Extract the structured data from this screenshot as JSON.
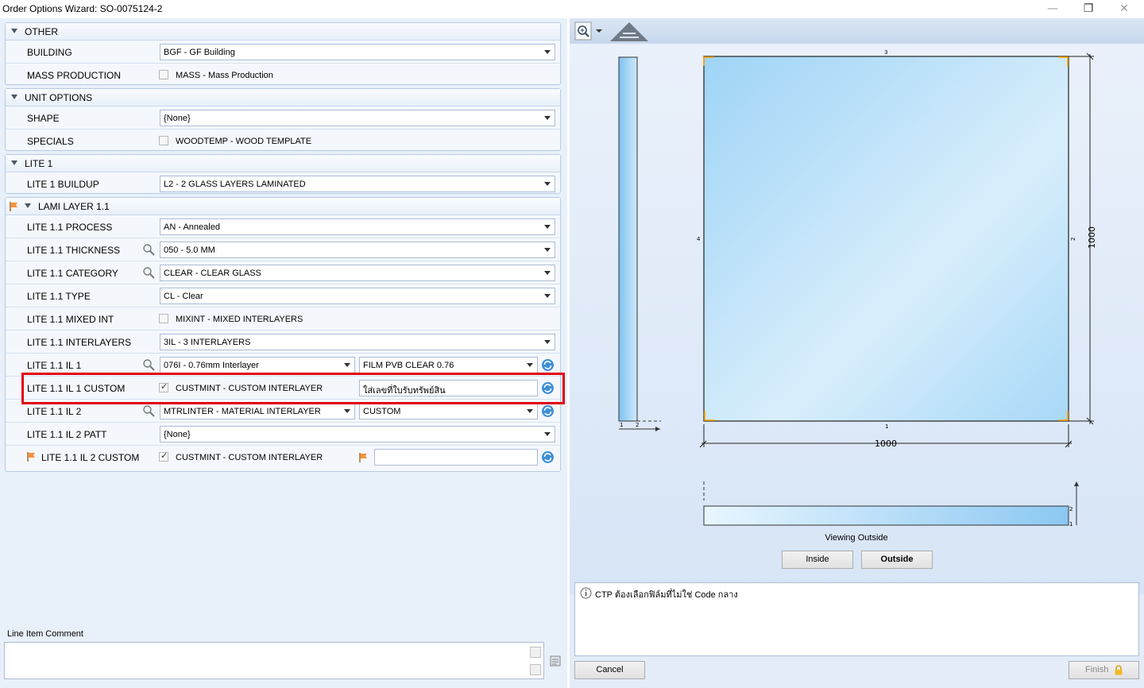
{
  "window": {
    "title": "Order Options Wizard: SO-0075124-2"
  },
  "groups": {
    "other": {
      "title": "OTHER",
      "building": {
        "label": "BUILDING",
        "value": "BGF - GF Building"
      },
      "mass": {
        "label": "MASS PRODUCTION",
        "option": "MASS - Mass Production",
        "checked": false
      }
    },
    "unit": {
      "title": "UNIT OPTIONS",
      "shape": {
        "label": "SHAPE",
        "value": "{None}"
      },
      "specials": {
        "label": "SPECIALS",
        "option": "WOODTEMP - WOOD TEMPLATE",
        "checked": false
      }
    },
    "lite1": {
      "title": "LITE 1",
      "buildup": {
        "label": "LITE 1 BUILDUP",
        "value": "L2 - 2 GLASS LAYERS LAMINATED"
      }
    },
    "lami": {
      "title": "LAMI LAYER 1.1",
      "process": {
        "label": "LITE 1.1 PROCESS",
        "value": "AN - Annealed"
      },
      "thickness": {
        "label": "LITE 1.1 THICKNESS",
        "value": "050 - 5.0 MM"
      },
      "category": {
        "label": "LITE 1.1 CATEGORY",
        "value": "CLEAR - CLEAR GLASS"
      },
      "type": {
        "label": "LITE 1.1 TYPE",
        "value": "CL - Clear"
      },
      "mixed": {
        "label": "LITE 1.1 MIXED INT",
        "option": "MIXINT - MIXED INTERLAYERS",
        "checked": false
      },
      "interlayers": {
        "label": "LITE 1.1 INTERLAYERS",
        "value": "3IL - 3 INTERLAYERS"
      },
      "il1": {
        "label": "LITE 1.1 IL 1",
        "value": "076I - 0.76mm Interlayer",
        "value2": "FILM PVB CLEAR 0.76"
      },
      "il1custom": {
        "label": "LITE 1.1 IL 1 CUSTOM",
        "option": "CUSTMINT - CUSTOM INTERLAYER",
        "checked": true,
        "text": "ใส่เลขที่ใบรับทรัพย์สิน"
      },
      "il2": {
        "label": "LITE 1.1 IL 2",
        "value": "MTRLINTER - MATERIAL INTERLAYER",
        "value2": "CUSTOM"
      },
      "il2patt": {
        "label": "LITE 1.1 IL 2 PATT",
        "value": "{None}"
      },
      "il2custom": {
        "label": "LITE 1.1 IL 2 CUSTOM",
        "option": "CUSTMINT - CUSTOM INTERLAYER",
        "checked": true,
        "text": ""
      }
    }
  },
  "comment": {
    "label": "Line Item Comment",
    "value": ""
  },
  "drawing": {
    "top_edge": "3",
    "right_edge": "2",
    "bottom_edge": "1",
    "left_edge": "4",
    "width_dim": "1000",
    "height_dim": "1000",
    "side_marks": [
      "1",
      "2"
    ],
    "viewing": "Viewing Outside"
  },
  "view_buttons": {
    "inside": "Inside",
    "outside": "Outside",
    "active": "Outside"
  },
  "message": "CTP ต้องเลือกฟิล์มที่ไม่ใช่ Code กลาง",
  "buttons": {
    "cancel": "Cancel",
    "finish": "Finish"
  },
  "colors": {
    "highlight": "#e10010",
    "glass": "#a7d8f7",
    "accent": "#ffa500"
  }
}
